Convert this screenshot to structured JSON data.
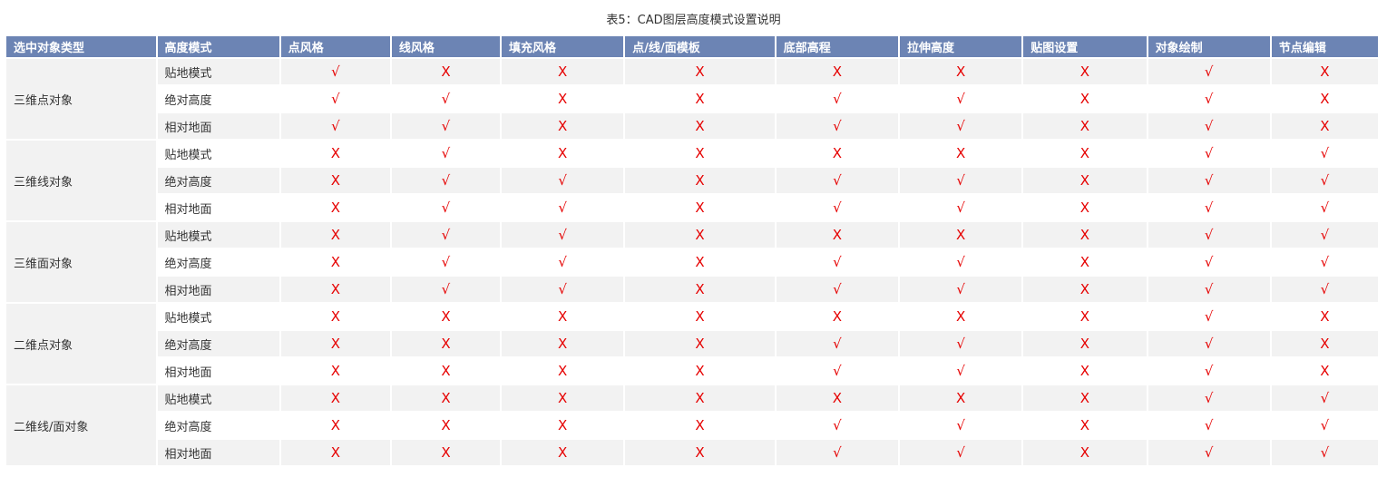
{
  "title": "表5：CAD图层高度模式设置说明",
  "colors": {
    "header_bg": "#6c84b4",
    "mark_color": "#e60000",
    "stripe": "#f2f2f2"
  },
  "headers": [
    "选中对象类型",
    "高度模式",
    "点风格",
    "线风格",
    "填充风格",
    "点/线/面模板",
    "底部高程",
    "拉伸高度",
    "贴图设置",
    "对象绘制",
    "节点编辑"
  ],
  "symbols": {
    "yes": "√",
    "no": "X"
  },
  "groups": [
    {
      "type": "三维点对象",
      "rows": [
        {
          "mode": "贴地模式",
          "marks": [
            "√",
            "X",
            "X",
            "X",
            "X",
            "X",
            "X",
            "√",
            "X"
          ]
        },
        {
          "mode": "绝对高度",
          "marks": [
            "√",
            "√",
            "X",
            "X",
            "√",
            "√",
            "X",
            "√",
            "X"
          ]
        },
        {
          "mode": "相对地面",
          "marks": [
            "√",
            "√",
            "X",
            "X",
            "√",
            "√",
            "X",
            "√",
            "X"
          ]
        }
      ]
    },
    {
      "type": "三维线对象",
      "rows": [
        {
          "mode": "贴地模式",
          "marks": [
            "X",
            "√",
            "X",
            "X",
            "X",
            "X",
            "X",
            "√",
            "√"
          ]
        },
        {
          "mode": "绝对高度",
          "marks": [
            "X",
            "√",
            "√",
            "X",
            "√",
            "√",
            "X",
            "√",
            "√"
          ]
        },
        {
          "mode": "相对地面",
          "marks": [
            "X",
            "√",
            "√",
            "X",
            "√",
            "√",
            "X",
            "√",
            "√"
          ]
        }
      ]
    },
    {
      "type": "三维面对象",
      "rows": [
        {
          "mode": "贴地模式",
          "marks": [
            "X",
            "√",
            "√",
            "X",
            "X",
            "X",
            "X",
            "√",
            "√"
          ]
        },
        {
          "mode": "绝对高度",
          "marks": [
            "X",
            "√",
            "√",
            "X",
            "√",
            "√",
            "X",
            "√",
            "√"
          ]
        },
        {
          "mode": "相对地面",
          "marks": [
            "X",
            "√",
            "√",
            "X",
            "√",
            "√",
            "X",
            "√",
            "√"
          ]
        }
      ]
    },
    {
      "type": "二维点对象",
      "rows": [
        {
          "mode": "贴地模式",
          "marks": [
            "X",
            "X",
            "X",
            "X",
            "X",
            "X",
            "X",
            "√",
            "X"
          ]
        },
        {
          "mode": "绝对高度",
          "marks": [
            "X",
            "X",
            "X",
            "X",
            "√",
            "√",
            "X",
            "√",
            "X"
          ]
        },
        {
          "mode": "相对地面",
          "marks": [
            "X",
            "X",
            "X",
            "X",
            "√",
            "√",
            "X",
            "√",
            "X"
          ]
        }
      ]
    },
    {
      "type": "二维线/面对象",
      "rows": [
        {
          "mode": "贴地模式",
          "marks": [
            "X",
            "X",
            "X",
            "X",
            "X",
            "X",
            "X",
            "√",
            "√"
          ]
        },
        {
          "mode": "绝对高度",
          "marks": [
            "X",
            "X",
            "X",
            "X",
            "√",
            "√",
            "X",
            "√",
            "√"
          ]
        },
        {
          "mode": "相对地面",
          "marks": [
            "X",
            "X",
            "X",
            "X",
            "√",
            "√",
            "X",
            "√",
            "√"
          ]
        }
      ]
    }
  ]
}
